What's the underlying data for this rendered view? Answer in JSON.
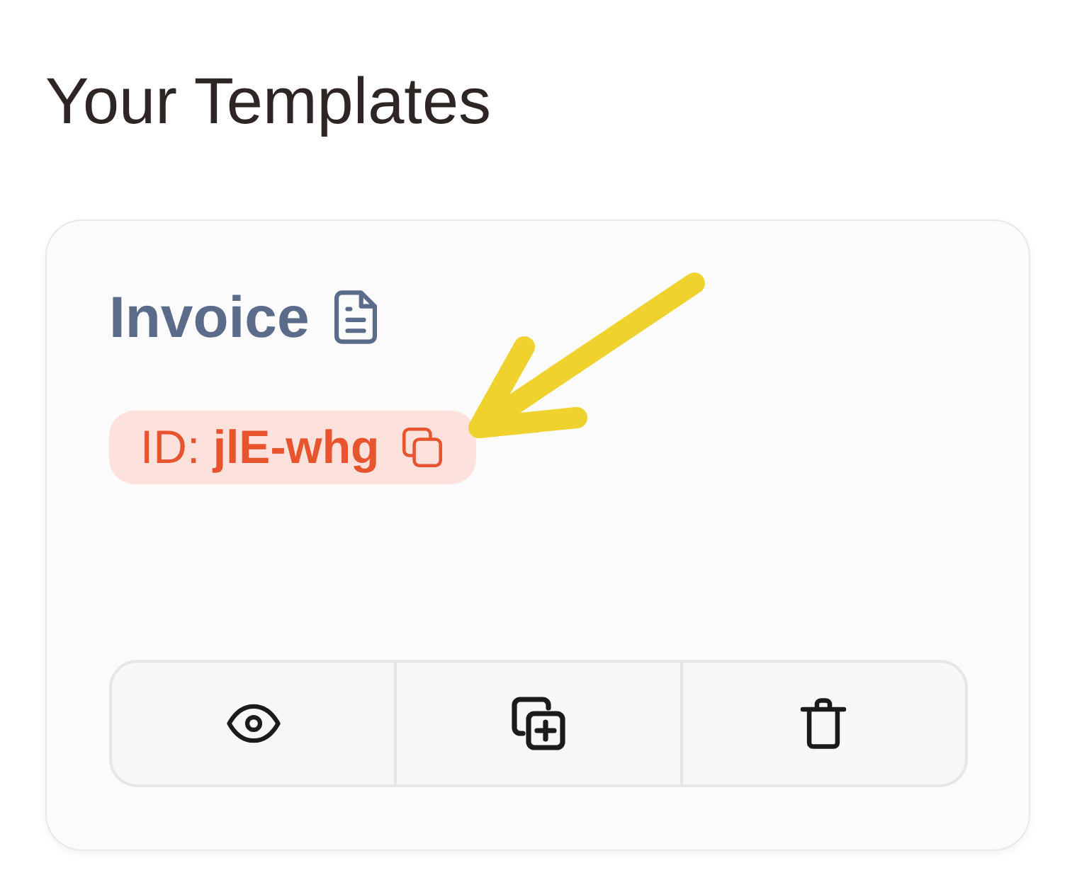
{
  "heading": "Your Templates",
  "templates": [
    {
      "name": "Invoice",
      "id_label": "ID: **jlE-whg**",
      "actions": [
        {
          "kind": "view"
        },
        {
          "kind": "duplicate"
        },
        {
          "kind": "delete"
        }
      ]
    }
  ]
}
